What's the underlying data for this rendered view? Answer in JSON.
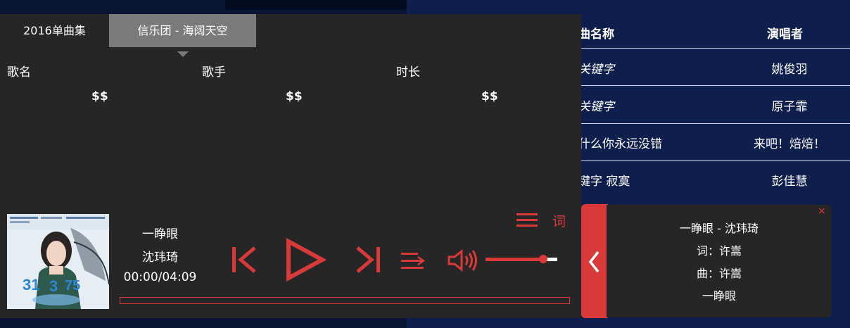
{
  "song_list": {
    "header_name": "曲名称",
    "header_artist": "演唱者",
    "rows": [
      {
        "name": "关键字",
        "artist": "姚俊羽"
      },
      {
        "name": "关键字",
        "artist": "原子霏"
      },
      {
        "name": "什么你永远没错",
        "artist": "来吧！焙焙！"
      },
      {
        "name": "键字 寂寞",
        "artist": "彭佳慧"
      }
    ]
  },
  "player": {
    "tabs": [
      {
        "label": "2016单曲集"
      },
      {
        "label": "信乐团 - 海阔天空"
      }
    ],
    "columns": {
      "name": "歌名",
      "artist": "歌手",
      "duration": "时长"
    },
    "placeholders": [
      "$$",
      "$$",
      "$$"
    ],
    "now_playing": {
      "title": "一睁眼",
      "artist": "沈玮琦",
      "time": "00:00/04:09"
    },
    "progress": 0,
    "volume": 0.8,
    "lyric_button": "词",
    "icons": {
      "prev": "skip-previous-icon",
      "play": "play-icon",
      "next": "skip-next-icon",
      "mode": "shuffle-icon",
      "volume": "volume-icon",
      "playlist": "playlist-menu-icon",
      "collapse": "chevron-left-icon",
      "close": "close-icon"
    },
    "accent_color": "#d83a3a"
  },
  "lyrics": {
    "close": "×",
    "lines": [
      "一睁眼 - 沈玮琦",
      "词：许嵩",
      "曲：许嵩",
      "一睁眼"
    ]
  }
}
